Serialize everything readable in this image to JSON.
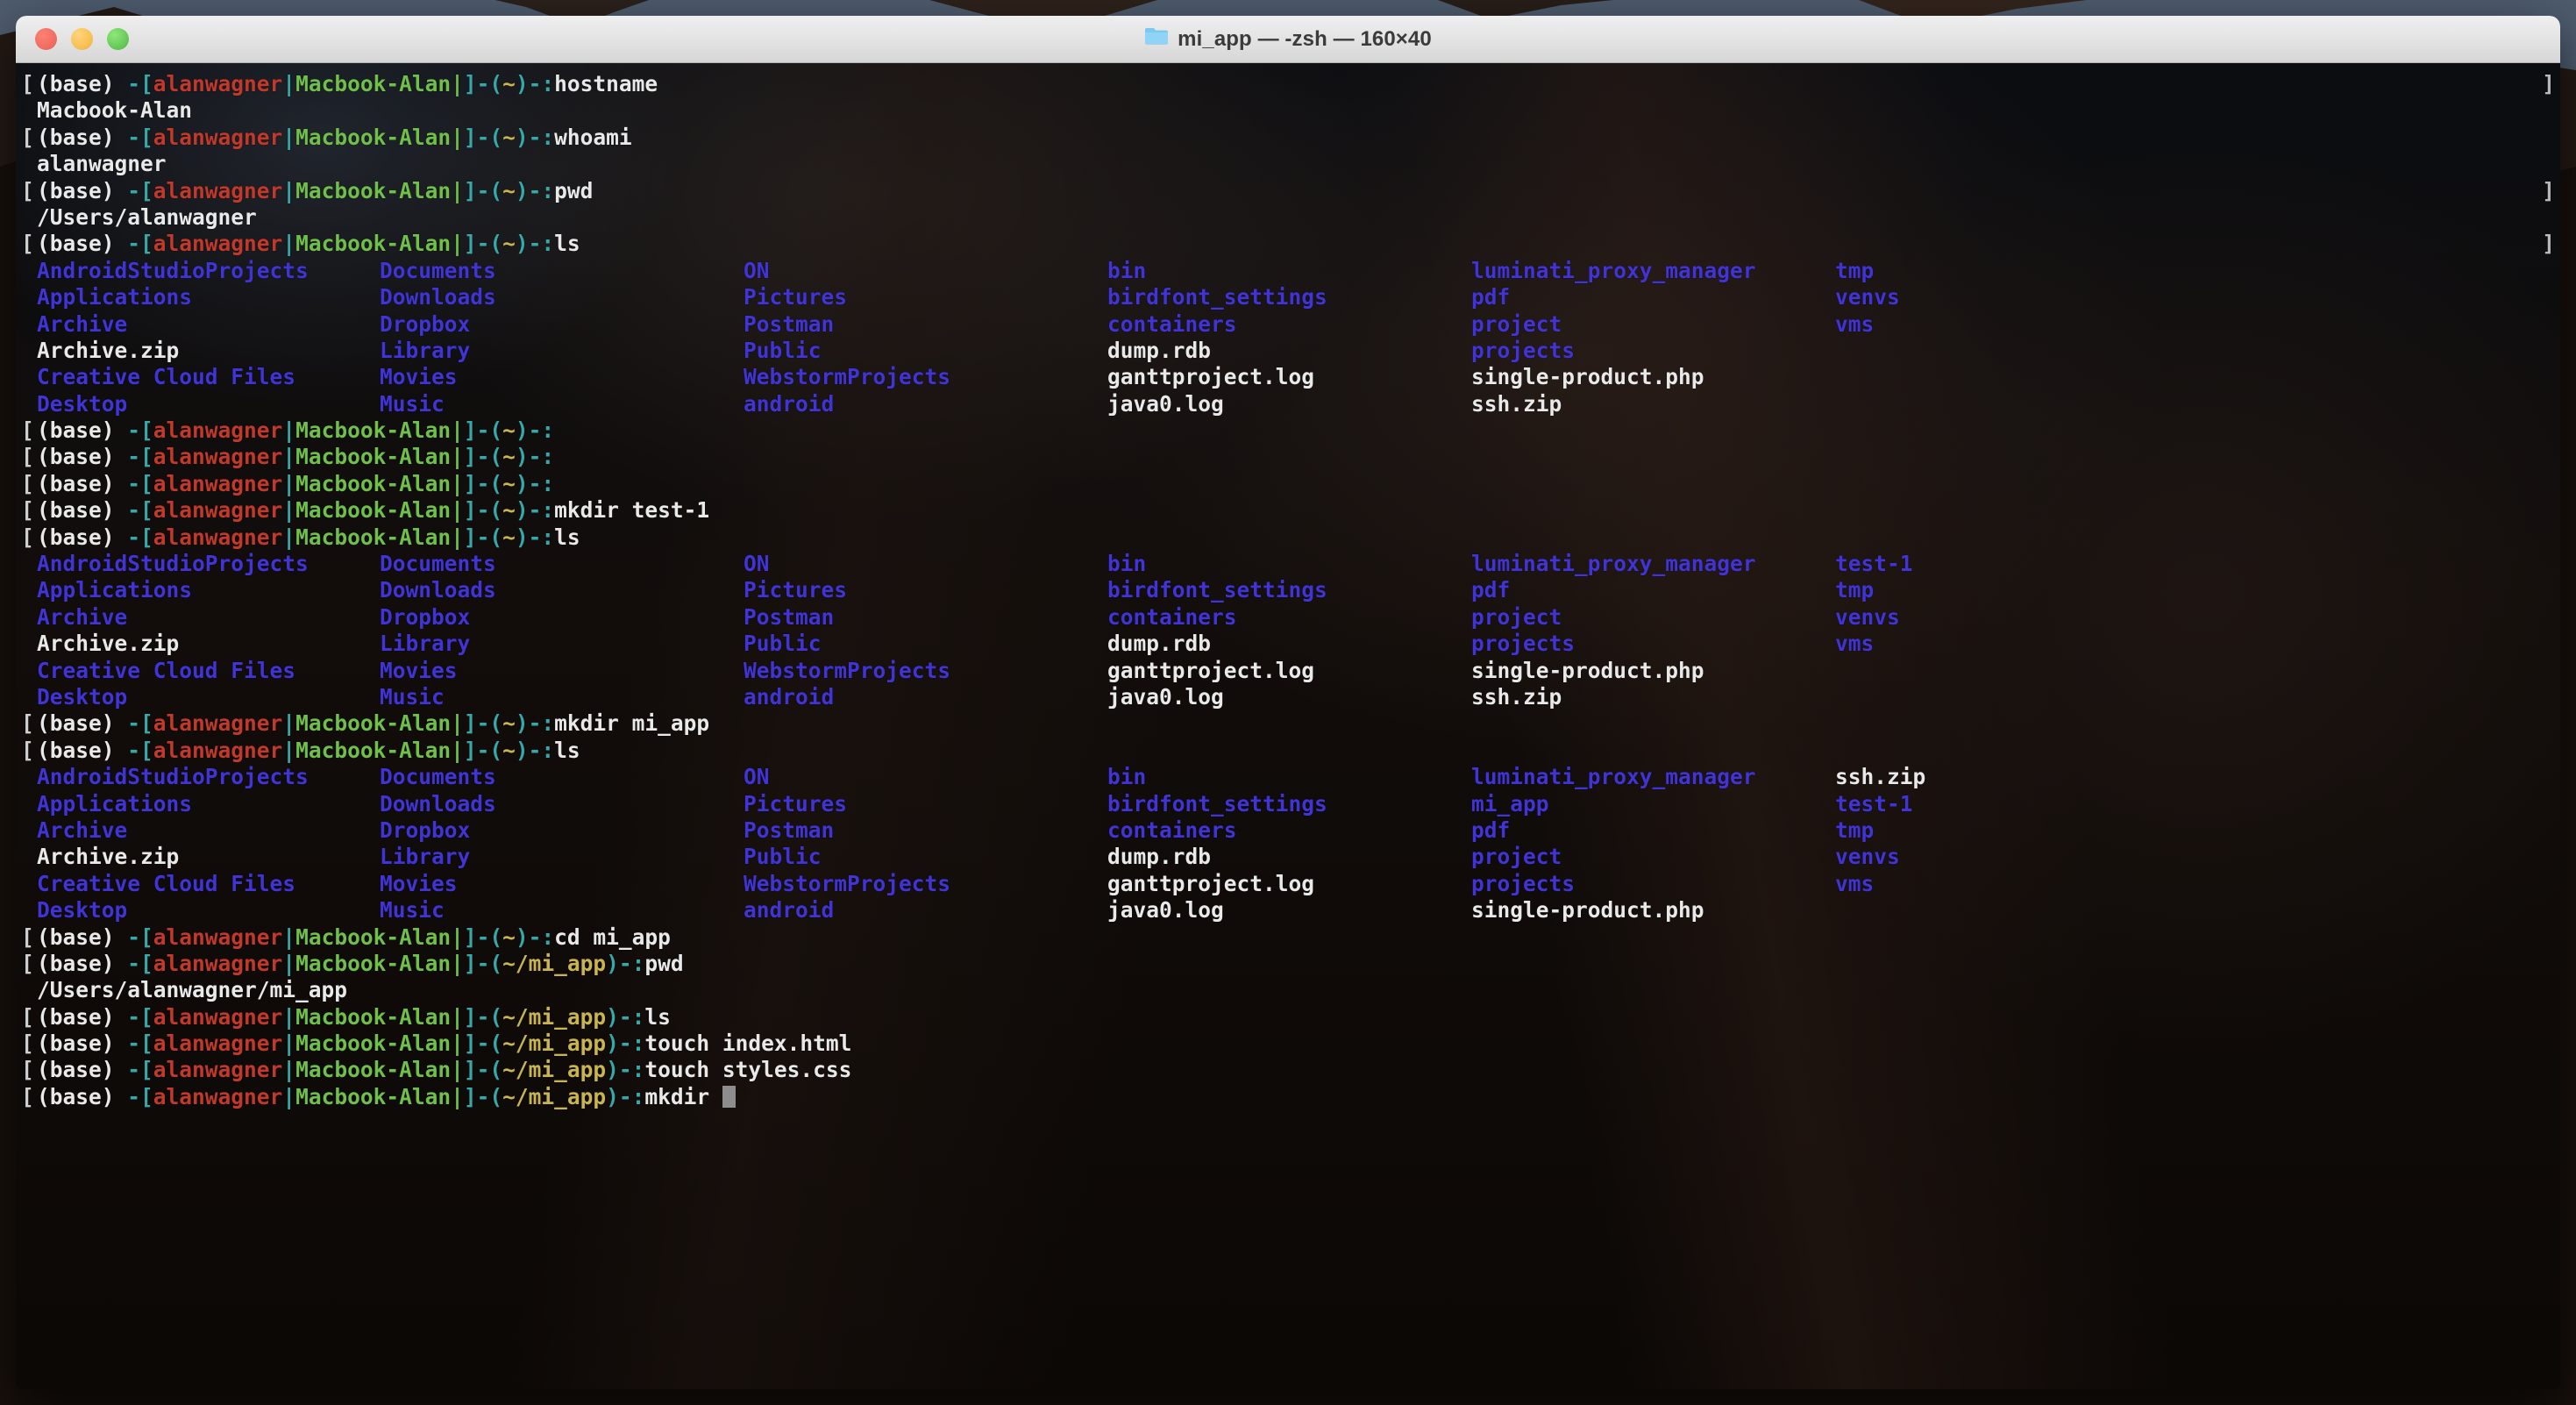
{
  "window": {
    "title": "mi_app — -zsh — 160×40",
    "folder_icon": "folder-icon",
    "traffic_lights": [
      {
        "name": "close-button",
        "color": "#ed6a5e"
      },
      {
        "name": "minimize-button",
        "color": "#f5bd4f"
      },
      {
        "name": "zoom-button",
        "color": "#61c554"
      }
    ]
  },
  "colors": {
    "background": "#07090c",
    "foreground": "#e9e9e9",
    "cyan": "#37a8a8",
    "red": "#c0392b",
    "green": "#6fbf4a",
    "yellow": "#c9b550",
    "blue": "#4134d6",
    "cursor": "#8d8d8d",
    "titlebar": "#e3e3e3"
  },
  "prompt": {
    "env": "(base)",
    "dash": "-[",
    "user": "alanwagner",
    "pipe": "|",
    "host": "Macbook-Alan|",
    "close_bracket": "]-(",
    "path_home": "~",
    "path_mi_app": "~/mi_app",
    "tail": ")-:"
  },
  "terminal": {
    "wrap_marker": "]",
    "cursor_glyph": "block-cursor",
    "commands": {
      "hostname": "hostname",
      "whoami": "whoami",
      "pwd": "pwd",
      "ls": "ls",
      "mkdir_test1": "mkdir test-1",
      "mkdir_mi_app": "mkdir mi_app",
      "cd_mi_app": "cd mi_app",
      "touch_index": "touch index.html",
      "touch_styles": "touch styles.css",
      "mkdir_empty": "mkdir ",
      "empty": ""
    },
    "outputs": {
      "hostname": "Macbook-Alan",
      "whoami": "alanwagner",
      "pwd_home": "/Users/alanwagner",
      "pwd_mi_app": "/Users/alanwagner/mi_app"
    },
    "ls_listing_1": [
      [
        {
          "text": "AndroidStudioProjects",
          "kind": "dir"
        },
        {
          "text": "Documents",
          "kind": "dir"
        },
        {
          "text": "ON",
          "kind": "dir"
        },
        {
          "text": "bin",
          "kind": "dir"
        },
        {
          "text": "luminati_proxy_manager",
          "kind": "dir"
        },
        {
          "text": "tmp",
          "kind": "dir"
        }
      ],
      [
        {
          "text": "Applications",
          "kind": "dir"
        },
        {
          "text": "Downloads",
          "kind": "dir"
        },
        {
          "text": "Pictures",
          "kind": "dir"
        },
        {
          "text": "birdfont_settings",
          "kind": "dir"
        },
        {
          "text": "pdf",
          "kind": "dir"
        },
        {
          "text": "venvs",
          "kind": "dir"
        }
      ],
      [
        {
          "text": "Archive",
          "kind": "dir"
        },
        {
          "text": "Dropbox",
          "kind": "dir"
        },
        {
          "text": "Postman",
          "kind": "dir"
        },
        {
          "text": "containers",
          "kind": "dir"
        },
        {
          "text": "project",
          "kind": "dir"
        },
        {
          "text": "vms",
          "kind": "dir"
        }
      ],
      [
        {
          "text": "Archive.zip",
          "kind": "file"
        },
        {
          "text": "Library",
          "kind": "dir"
        },
        {
          "text": "Public",
          "kind": "dir"
        },
        {
          "text": "dump.rdb",
          "kind": "file"
        },
        {
          "text": "projects",
          "kind": "dir"
        },
        {
          "text": "",
          "kind": "file"
        }
      ],
      [
        {
          "text": "Creative Cloud Files",
          "kind": "dir"
        },
        {
          "text": "Movies",
          "kind": "dir"
        },
        {
          "text": "WebstormProjects",
          "kind": "dir"
        },
        {
          "text": "ganttproject.log",
          "kind": "file"
        },
        {
          "text": "single-product.php",
          "kind": "file"
        },
        {
          "text": "",
          "kind": "file"
        }
      ],
      [
        {
          "text": "Desktop",
          "kind": "dir"
        },
        {
          "text": "Music",
          "kind": "dir"
        },
        {
          "text": "android",
          "kind": "dir"
        },
        {
          "text": "java0.log",
          "kind": "file"
        },
        {
          "text": "ssh.zip",
          "kind": "file"
        },
        {
          "text": "",
          "kind": "file"
        }
      ]
    ],
    "ls_listing_2": [
      [
        {
          "text": "AndroidStudioProjects",
          "kind": "dir"
        },
        {
          "text": "Documents",
          "kind": "dir"
        },
        {
          "text": "ON",
          "kind": "dir"
        },
        {
          "text": "bin",
          "kind": "dir"
        },
        {
          "text": "luminati_proxy_manager",
          "kind": "dir"
        },
        {
          "text": "test-1",
          "kind": "dir"
        }
      ],
      [
        {
          "text": "Applications",
          "kind": "dir"
        },
        {
          "text": "Downloads",
          "kind": "dir"
        },
        {
          "text": "Pictures",
          "kind": "dir"
        },
        {
          "text": "birdfont_settings",
          "kind": "dir"
        },
        {
          "text": "pdf",
          "kind": "dir"
        },
        {
          "text": "tmp",
          "kind": "dir"
        }
      ],
      [
        {
          "text": "Archive",
          "kind": "dir"
        },
        {
          "text": "Dropbox",
          "kind": "dir"
        },
        {
          "text": "Postman",
          "kind": "dir"
        },
        {
          "text": "containers",
          "kind": "dir"
        },
        {
          "text": "project",
          "kind": "dir"
        },
        {
          "text": "venvs",
          "kind": "dir"
        }
      ],
      [
        {
          "text": "Archive.zip",
          "kind": "file"
        },
        {
          "text": "Library",
          "kind": "dir"
        },
        {
          "text": "Public",
          "kind": "dir"
        },
        {
          "text": "dump.rdb",
          "kind": "file"
        },
        {
          "text": "projects",
          "kind": "dir"
        },
        {
          "text": "vms",
          "kind": "dir"
        }
      ],
      [
        {
          "text": "Creative Cloud Files",
          "kind": "dir"
        },
        {
          "text": "Movies",
          "kind": "dir"
        },
        {
          "text": "WebstormProjects",
          "kind": "dir"
        },
        {
          "text": "ganttproject.log",
          "kind": "file"
        },
        {
          "text": "single-product.php",
          "kind": "file"
        },
        {
          "text": "",
          "kind": "file"
        }
      ],
      [
        {
          "text": "Desktop",
          "kind": "dir"
        },
        {
          "text": "Music",
          "kind": "dir"
        },
        {
          "text": "android",
          "kind": "dir"
        },
        {
          "text": "java0.log",
          "kind": "file"
        },
        {
          "text": "ssh.zip",
          "kind": "file"
        },
        {
          "text": "",
          "kind": "file"
        }
      ]
    ],
    "ls_listing_3": [
      [
        {
          "text": "AndroidStudioProjects",
          "kind": "dir"
        },
        {
          "text": "Documents",
          "kind": "dir"
        },
        {
          "text": "ON",
          "kind": "dir"
        },
        {
          "text": "bin",
          "kind": "dir"
        },
        {
          "text": "luminati_proxy_manager",
          "kind": "dir"
        },
        {
          "text": "ssh.zip",
          "kind": "file"
        }
      ],
      [
        {
          "text": "Applications",
          "kind": "dir"
        },
        {
          "text": "Downloads",
          "kind": "dir"
        },
        {
          "text": "Pictures",
          "kind": "dir"
        },
        {
          "text": "birdfont_settings",
          "kind": "dir"
        },
        {
          "text": "mi_app",
          "kind": "dir"
        },
        {
          "text": "test-1",
          "kind": "dir"
        }
      ],
      [
        {
          "text": "Archive",
          "kind": "dir"
        },
        {
          "text": "Dropbox",
          "kind": "dir"
        },
        {
          "text": "Postman",
          "kind": "dir"
        },
        {
          "text": "containers",
          "kind": "dir"
        },
        {
          "text": "pdf",
          "kind": "dir"
        },
        {
          "text": "tmp",
          "kind": "dir"
        }
      ],
      [
        {
          "text": "Archive.zip",
          "kind": "file"
        },
        {
          "text": "Library",
          "kind": "dir"
        },
        {
          "text": "Public",
          "kind": "dir"
        },
        {
          "text": "dump.rdb",
          "kind": "file"
        },
        {
          "text": "project",
          "kind": "dir"
        },
        {
          "text": "venvs",
          "kind": "dir"
        }
      ],
      [
        {
          "text": "Creative Cloud Files",
          "kind": "dir"
        },
        {
          "text": "Movies",
          "kind": "dir"
        },
        {
          "text": "WebstormProjects",
          "kind": "dir"
        },
        {
          "text": "ganttproject.log",
          "kind": "file"
        },
        {
          "text": "projects",
          "kind": "dir"
        },
        {
          "text": "vms",
          "kind": "dir"
        }
      ],
      [
        {
          "text": "Desktop",
          "kind": "dir"
        },
        {
          "text": "Music",
          "kind": "dir"
        },
        {
          "text": "android",
          "kind": "dir"
        },
        {
          "text": "java0.log",
          "kind": "file"
        },
        {
          "text": "single-product.php",
          "kind": "file"
        },
        {
          "text": "",
          "kind": "file"
        }
      ]
    ]
  }
}
